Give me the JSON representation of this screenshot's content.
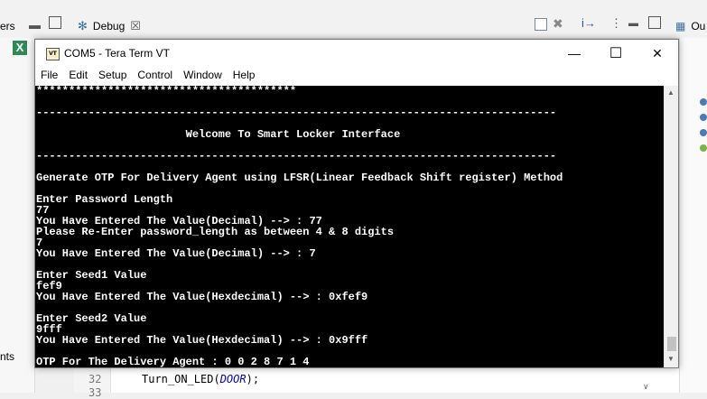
{
  "ide": {
    "left_tab_fragment": "ers",
    "debug_tab_label": "Debug",
    "debug_tab_close": "☒",
    "right_tab_fragment": "Ou",
    "left_lower_fragment": "nts",
    "code": {
      "line_numbers": [
        "32",
        "33"
      ],
      "statement_func": "Turn_ON_LED(",
      "statement_arg": "DOOR",
      "statement_end": ");"
    }
  },
  "teraterm": {
    "app_icon_text": "VT",
    "title": "COM5 - Tera Term VT",
    "window_buttons": {
      "minimize": "—",
      "maximize": "☐",
      "close": "✕"
    },
    "menu": [
      "File",
      "Edit",
      "Setup",
      "Control",
      "Window",
      "Help"
    ],
    "terminal_lines": [
      "****************************************",
      "",
      "--------------------------------------------------------------------------------",
      "",
      "                       Welcome To Smart Locker Interface",
      "",
      "--------------------------------------------------------------------------------",
      "",
      "Generate OTP For Delivery Agent using LFSR(Linear Feedback Shift register) Method",
      "",
      "Enter Password Length",
      "77",
      "You Have Entered The Value(Decimal) --> : 77",
      "Please Re-Enter password_length as between 4 & 8 digits",
      "7",
      "You Have Entered The Value(Decimal) --> : 7",
      "",
      "Enter Seed1 Value",
      "fef9",
      "You Have Entered The Value(Hexdecimal) --> : 0xfef9",
      "",
      "Enter Seed2 Value",
      "9fff",
      "You Have Entered The Value(Hexdecimal) --> : 0x9fff",
      "",
      "OTP For The Delivery Agent : 0 0 2 8 7 1 4"
    ]
  }
}
